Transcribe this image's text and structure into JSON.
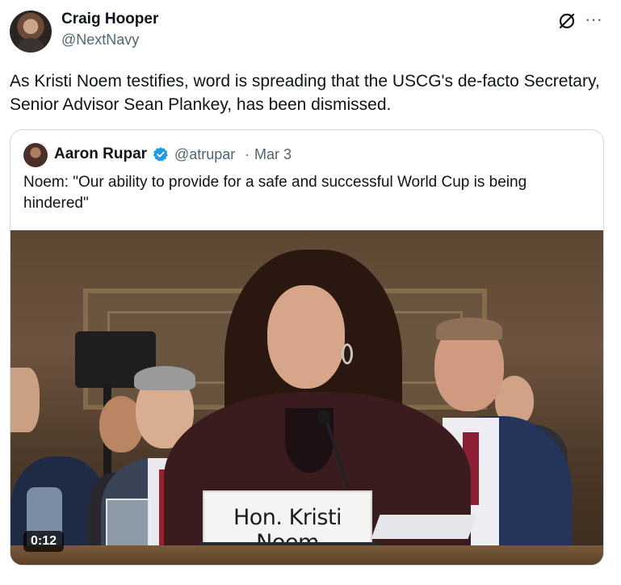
{
  "tweet": {
    "author": {
      "display_name": "Craig Hooper",
      "handle": "@NextNavy"
    },
    "text": "As Kristi Noem testifies, word is spreading that the USCG's de-facto Secretary, Senior Advisor Sean Plankey, has been dismissed.",
    "actions": {
      "grok_icon": "grok-slash-circle-icon",
      "more_icon": "more-horizontal-icon",
      "more_glyph": "···"
    }
  },
  "quote": {
    "author": {
      "display_name": "Aaron Rupar",
      "handle": "@atrupar",
      "separator": "·",
      "date": "Mar 3",
      "verified": true,
      "verified_color": "#1d9bf0"
    },
    "text": "Noem: \"Our ability to provide for a safe and successful World Cup is being hindered\"",
    "video": {
      "nameplate_text": "Hon. Kristi Noem",
      "duration": "0:12"
    }
  }
}
